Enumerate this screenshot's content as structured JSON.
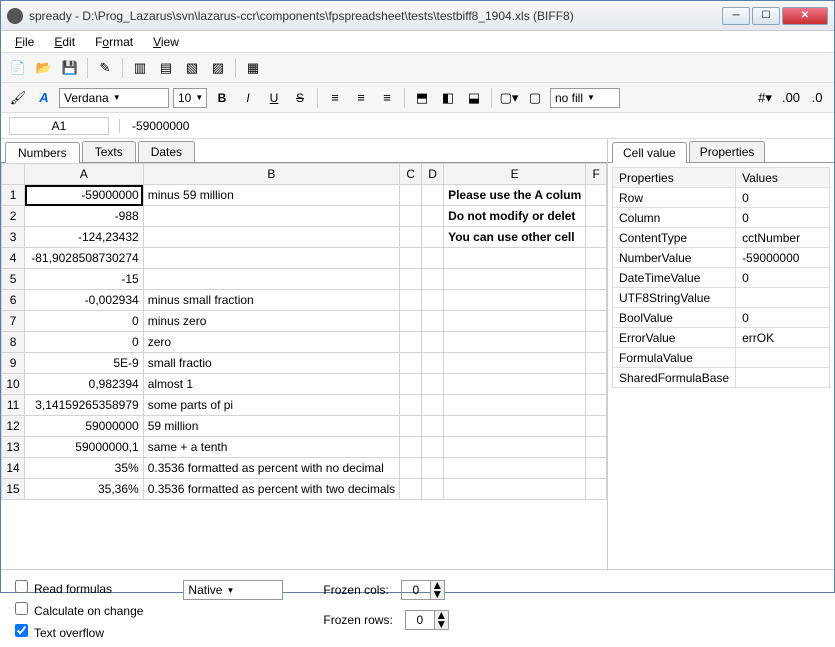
{
  "window": {
    "title": "spready - D:\\Prog_Lazarus\\svn\\lazarus-ccr\\components\\fpspreadsheet\\tests\\testbiff8_1904.xls (BIFF8)"
  },
  "menu": {
    "file": "File",
    "edit": "Edit",
    "format": "Format",
    "view": "View"
  },
  "font": {
    "name": "Verdana",
    "size": "10",
    "nofill": "no fill"
  },
  "cellbar": {
    "ref": "A1",
    "value": "-59000000"
  },
  "sheets": {
    "t1": "Numbers",
    "t2": "Texts",
    "t3": "Dates"
  },
  "cols": [
    "A",
    "B",
    "C",
    "D",
    "E",
    "F"
  ],
  "rows": [
    {
      "n": "1",
      "a": "-59000000",
      "b": "minus 59 million",
      "e": "Please use the A colum",
      "bold": true,
      "sel": true
    },
    {
      "n": "2",
      "a": "-988",
      "b": "",
      "e": "Do not modify or delet",
      "bold": true
    },
    {
      "n": "3",
      "a": "-124,23432",
      "b": "",
      "e": "You can use other cell",
      "bold": true
    },
    {
      "n": "4",
      "a": "-81,9028508730274",
      "b": "",
      "e": ""
    },
    {
      "n": "5",
      "a": "-15",
      "b": "",
      "e": ""
    },
    {
      "n": "6",
      "a": "-0,002934",
      "b": "minus small fraction",
      "e": ""
    },
    {
      "n": "7",
      "a": "0",
      "b": "minus zero",
      "e": ""
    },
    {
      "n": "8",
      "a": "0",
      "b": "zero",
      "e": ""
    },
    {
      "n": "9",
      "a": "5E-9",
      "b": "small fractio",
      "e": ""
    },
    {
      "n": "10",
      "a": "0,982394",
      "b": "almost 1",
      "e": ""
    },
    {
      "n": "11",
      "a": "3,14159265358979",
      "b": "some parts of pi",
      "e": ""
    },
    {
      "n": "12",
      "a": "59000000",
      "b": "59 million",
      "e": ""
    },
    {
      "n": "13",
      "a": "59000000,1",
      "b": "same + a tenth",
      "e": ""
    },
    {
      "n": "14",
      "a": "35%",
      "b": "0.3536 formatted as percent with no decimal",
      "e": ""
    },
    {
      "n": "15",
      "a": "35,36%",
      "b": "0.3536 formatted as percent with two decimals",
      "e": ""
    }
  ],
  "proptabs": {
    "t1": "Cell value",
    "t2": "Properties"
  },
  "propheader": {
    "p": "Properties",
    "v": "Values"
  },
  "props": [
    {
      "k": "Row",
      "v": "0"
    },
    {
      "k": "Column",
      "v": "0"
    },
    {
      "k": "ContentType",
      "v": "cctNumber"
    },
    {
      "k": "NumberValue",
      "v": "-59000000"
    },
    {
      "k": "DateTimeValue",
      "v": "0"
    },
    {
      "k": "UTF8StringValue",
      "v": ""
    },
    {
      "k": "BoolValue",
      "v": "0"
    },
    {
      "k": "ErrorValue",
      "v": "errOK"
    },
    {
      "k": "FormulaValue",
      "v": ""
    },
    {
      "k": "SharedFormulaBase",
      "v": ""
    }
  ],
  "bottom": {
    "read": "Read formulas",
    "calc": "Calculate on change",
    "overflow": "Text overflow",
    "native": "Native",
    "fcols": "Frozen cols:",
    "frows": "Frozen rows:",
    "fcv": "0",
    "frv": "0"
  }
}
